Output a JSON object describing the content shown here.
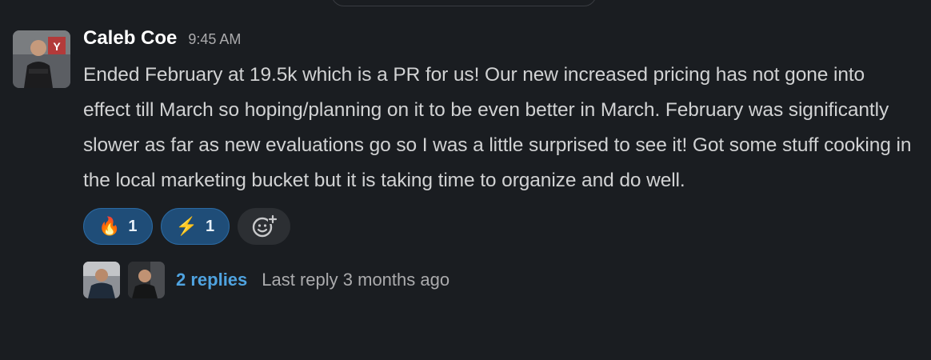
{
  "message": {
    "author": "Caleb Coe",
    "timestamp": "9:45 AM",
    "text": "Ended February at 19.5k which is a PR for us! Our new increased pricing has not gone into effect till March so hoping/planning on it to be even better in March. February was significantly slower as far as new evaluations go so I was a little surprised to see it! Got some stuff cooking in the local marketing bucket but it is taking time to organize and do well."
  },
  "reactions": [
    {
      "emoji": "🔥",
      "icon": "fire-emoji",
      "count": "1"
    },
    {
      "emoji": "⚡",
      "icon": "high-voltage-emoji",
      "count": "1"
    }
  ],
  "add_reaction": {
    "icon": "add-reaction-icon"
  },
  "thread": {
    "replies_label": "2 replies",
    "last_reply": "Last reply 3 months ago"
  },
  "colors": {
    "background": "#1a1d21",
    "reaction_active": "#1f4d78",
    "link": "#4fa3e0",
    "muted": "#ababad"
  }
}
